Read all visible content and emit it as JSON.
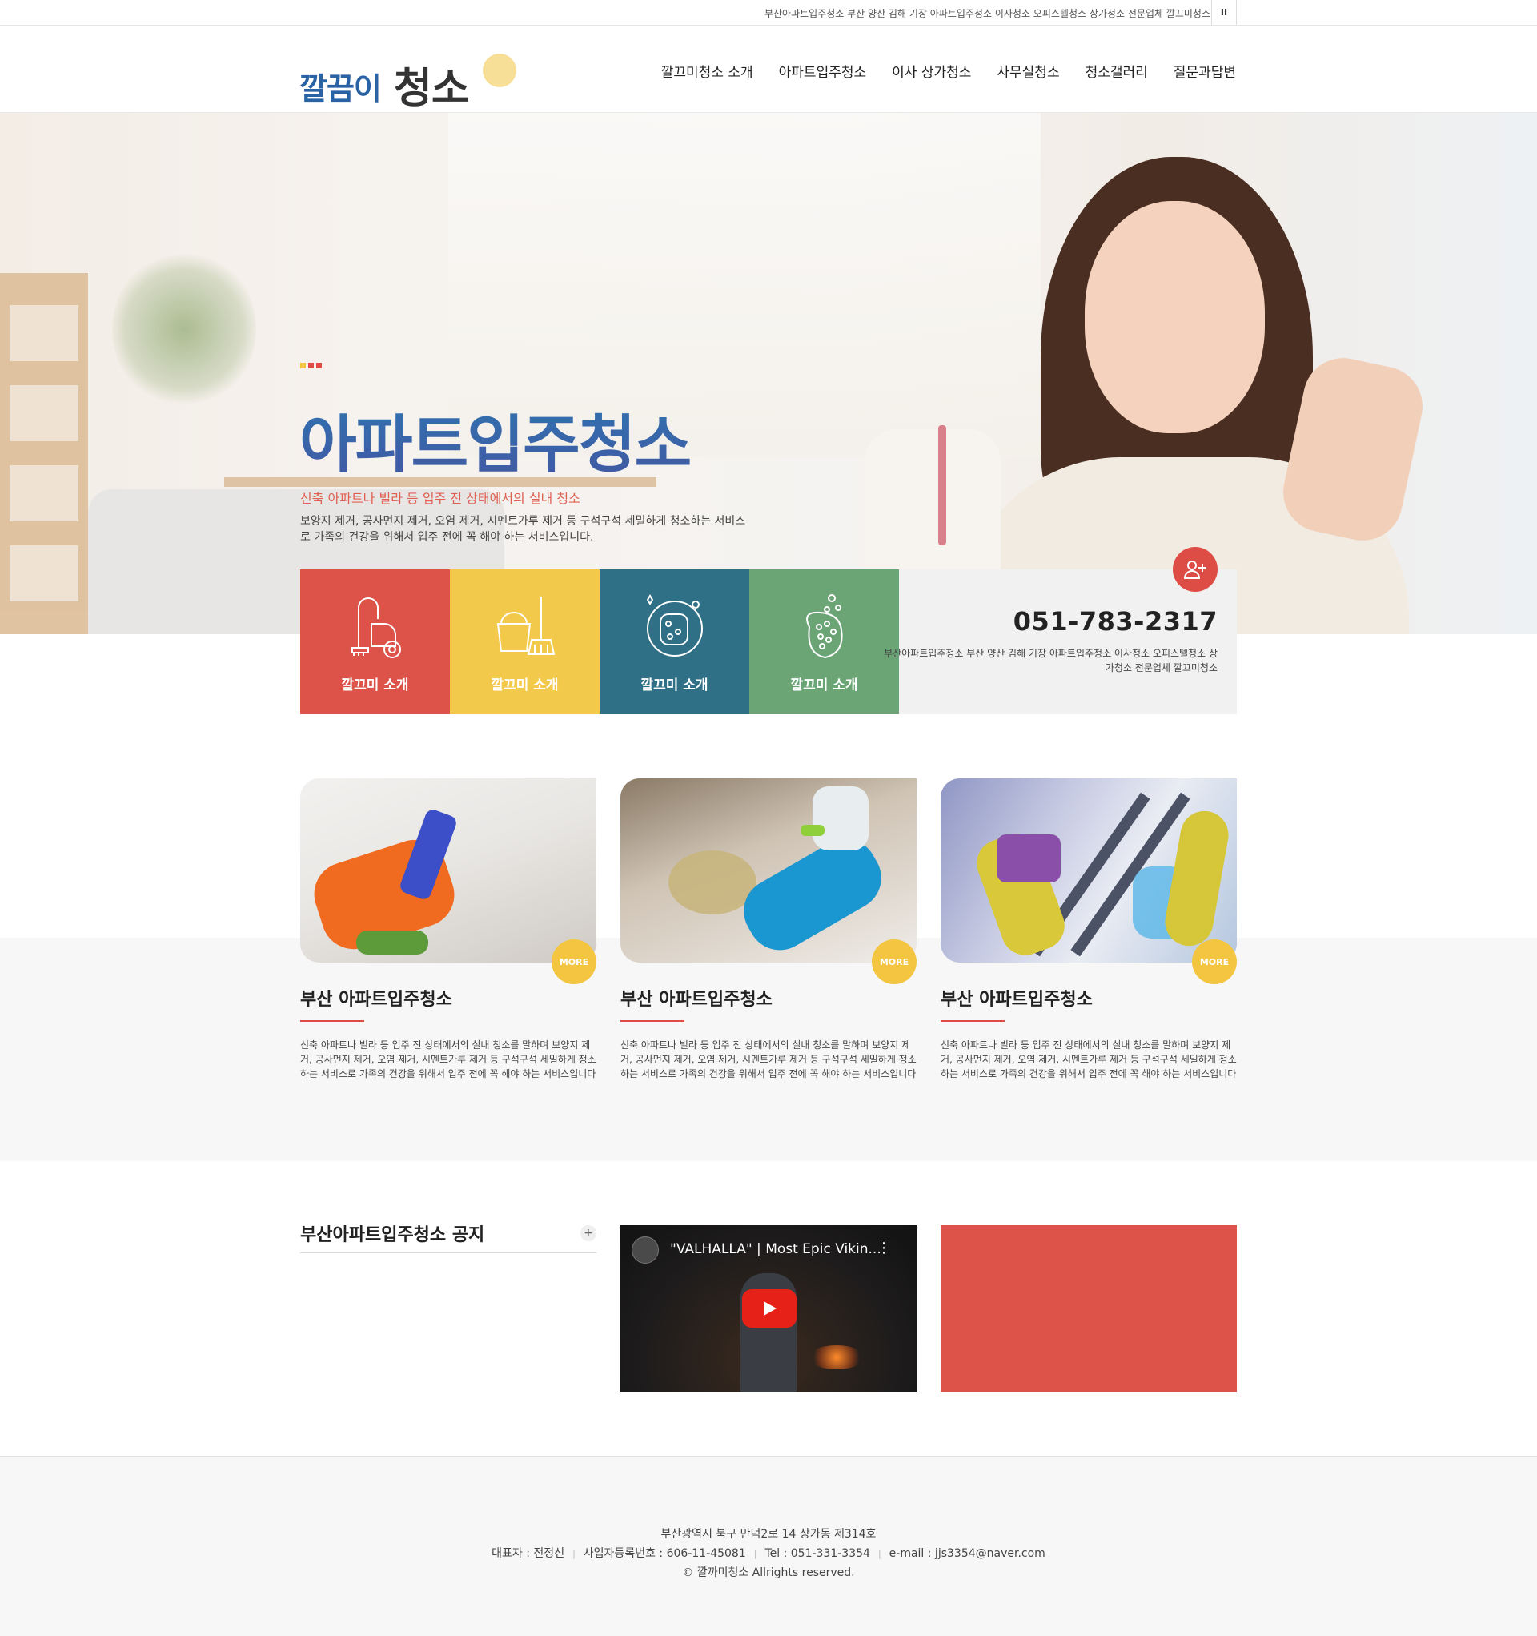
{
  "topbar": {
    "text": "부산아파트입주청소 부산 양산 김해 기장 아파트입주청소 이사청소 오피스텔청소 상가청소 전문업체 깔끄미청소",
    "pause_label": "II"
  },
  "header": {
    "logo_part1": "깔끔이",
    "logo_part2": "청소",
    "nav": [
      "깔끄미청소 소개",
      "아파트입주청소",
      "이사 상가청소",
      "사무실청소",
      "청소갤러리",
      "질문과답변"
    ]
  },
  "hero": {
    "title": "아파트입주청소",
    "subtitle": "신축 아파트나 빌라 등 입주 전 상태에서의 실내 청소",
    "description": "보양지 제거, 공사먼지 제거, 오염 제거, 시멘트가루 제거 등 구석구석 세밀하게 청소하는 서비스로 가족의 건강을 위해서 입주 전에 꼭 해야 하는 서비스입니다.",
    "dot_colors": [
      "#f3c540",
      "#dd4d45",
      "#dd4d45"
    ]
  },
  "services": [
    {
      "label": "깔끄미 소개",
      "color": "#dd5249",
      "icon": "vacuum-icon"
    },
    {
      "label": "깔끄미 소개",
      "color": "#f3c94c",
      "icon": "bucket-broom-icon"
    },
    {
      "label": "깔끄미 소개",
      "color": "#307086",
      "icon": "sponge-bubbles-icon"
    },
    {
      "label": "깔끄미 소개",
      "color": "#6ba576",
      "icon": "scrub-sponge-icon"
    }
  ],
  "contact": {
    "phone": "051-783-2317",
    "description": "부산아파트입주청소 부산 양산 김해 기장 아파트입주청소 이사청소 오피스텔청소 상가청소 전문업체 깔끄미청소",
    "icon": "add-user-icon"
  },
  "cards": [
    {
      "title": "부산 아파트입주청소",
      "more": "MORE",
      "description": "신축 아파트나 빌라 등 입주 전 상태에서의 실내 청소를 말하며 보양지 제거, 공사먼지 제거, 오염 제거, 시멘트가루 제거 등 구석구석 세밀하게 청소하는 서비스로 가족의 건강을 위해서 입주 전에 꼭 해야 하는 서비스입니다"
    },
    {
      "title": "부산 아파트입주청소",
      "more": "MORE",
      "description": "신축 아파트나 빌라 등 입주 전 상태에서의 실내 청소를 말하며 보양지 제거, 공사먼지 제거, 오염 제거, 시멘트가루 제거 등 구석구석 세밀하게 청소하는 서비스로 가족의 건강을 위해서 입주 전에 꼭 해야 하는 서비스입니다"
    },
    {
      "title": "부산 아파트입주청소",
      "more": "MORE",
      "description": "신축 아파트나 빌라 등 입주 전 상태에서의 실내 청소를 말하며 보양지 제거, 공사먼지 제거, 오염 제거, 시멘트가루 제거 등 구석구석 세밀하게 청소하는 서비스로 가족의 건강을 위해서 입주 전에 꼭 해야 하는 서비스입니다"
    }
  ],
  "notice": {
    "title": "부산아파트입주청소 공지",
    "plus": "+"
  },
  "video": {
    "title": "\"VALHALLA\" | Most Epic Vikin...",
    "menu": "⋮"
  },
  "footer": {
    "address": "부산광역시 북구 만덕2로 14 상가동 제314호",
    "representative": "대표자 : 전정선",
    "business_no": "사업자등록번호 : 606-11-45081",
    "tel": "Tel : 051-331-3354",
    "email": "e-mail : jjs3354@naver.com",
    "separator": "|",
    "copyright": "© 깔까미청소 Allrights reserved."
  }
}
